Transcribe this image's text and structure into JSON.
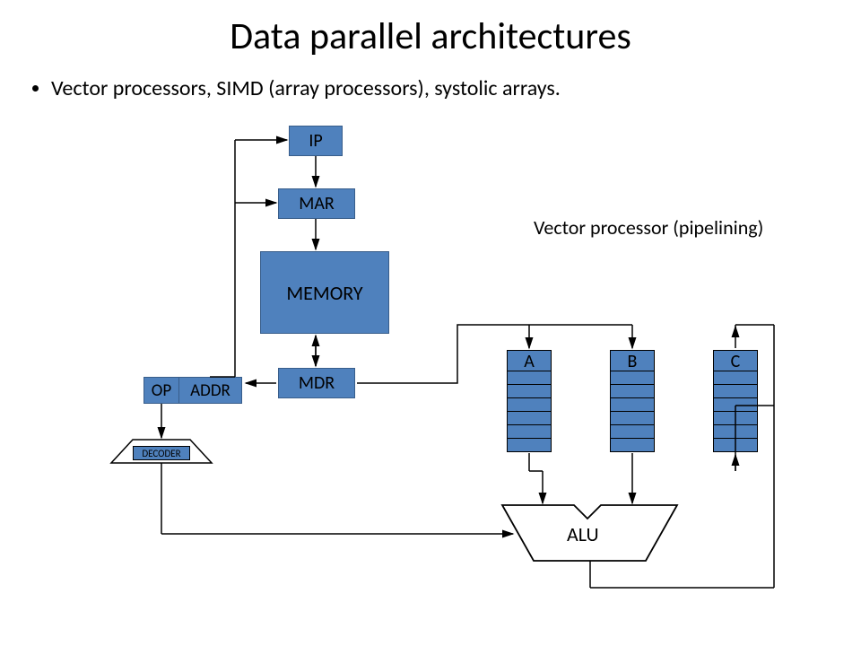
{
  "title": "Data parallel architectures",
  "bullet": "Vector processors, SIMD (array processors), systolic arrays.",
  "caption": "Vector processor (pipelining)",
  "blocks": {
    "ip": "IP",
    "mar": "MAR",
    "memory": "MEMORY",
    "mdr": "MDR",
    "op": "OP",
    "addr": "ADDR",
    "decoder": "DECODER"
  },
  "registers": {
    "a": "A",
    "b": "B",
    "c": "C"
  },
  "alu": "ALU"
}
